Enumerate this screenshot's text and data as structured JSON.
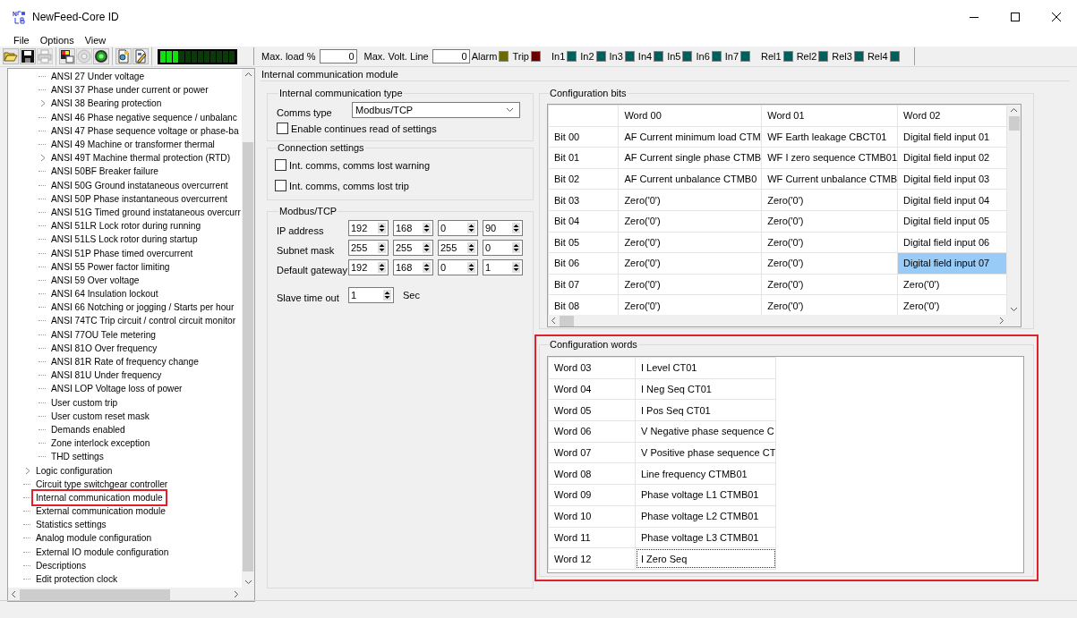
{
  "window": {
    "title": "NewFeed-Core ID"
  },
  "menu": [
    "File",
    "Options",
    "View"
  ],
  "toolbar": {
    "groups": [
      [
        {
          "kind": "open",
          "disabled": false
        },
        {
          "kind": "save",
          "disabled": false
        },
        {
          "kind": "print",
          "disabled": true
        }
      ],
      [
        {
          "kind": "image",
          "disabled": false
        },
        {
          "kind": "disc",
          "disabled": true
        },
        {
          "kind": "target",
          "disabled": false
        }
      ],
      [
        {
          "kind": "doc-gear",
          "disabled": false
        },
        {
          "kind": "doc-edit",
          "disabled": false
        }
      ]
    ],
    "meter": {
      "level": 0.25
    },
    "fields": [
      {
        "label": "Max. load %",
        "value": "0"
      },
      {
        "label": "Max. Volt. Line",
        "value": "0"
      }
    ],
    "indicator_groups": [
      [
        {
          "label": "Alarm",
          "color": "#6b6b00"
        },
        {
          "label": "Trip",
          "color": "#6b0000"
        }
      ],
      [
        {
          "label": "In1",
          "color": "#005f5a"
        },
        {
          "label": "In2",
          "color": "#005f5a"
        },
        {
          "label": "In3",
          "color": "#005f5a"
        },
        {
          "label": "In4",
          "color": "#005f5a"
        },
        {
          "label": "In5",
          "color": "#005f5a"
        },
        {
          "label": "In6",
          "color": "#005f5a"
        },
        {
          "label": "In7",
          "color": "#005f5a"
        }
      ],
      [
        {
          "label": "Rel1",
          "color": "#005f5a"
        },
        {
          "label": "Rel2",
          "color": "#005f5a"
        },
        {
          "label": "Rel3",
          "color": "#005f5a"
        },
        {
          "label": "Rel4",
          "color": "#005f5a"
        }
      ]
    ]
  },
  "tree": {
    "items": [
      {
        "children": [
          {
            "label": "ANSI 27  Under voltage",
            "collapsed": false,
            "marked": false
          },
          {
            "label": "ANSI 37  Phase under current or power",
            "collapsed": false,
            "marked": false
          },
          {
            "label": "ANSI 38  Bearing protection",
            "collapsed": true,
            "marked": false
          },
          {
            "label": "ANSI 46  Phase negative sequence / unbalanc",
            "collapsed": false,
            "marked": false
          },
          {
            "label": "ANSI 47  Phase sequence voltage or phase-ba",
            "collapsed": false,
            "marked": false
          },
          {
            "label": "ANSI 49  Machine or transformer thermal",
            "collapsed": false,
            "marked": false
          },
          {
            "label": "ANSI 49T  Machine thermal protection (RTD)",
            "collapsed": true,
            "marked": false
          },
          {
            "label": "ANSI 50BF Breaker failure",
            "collapsed": false,
            "marked": false
          },
          {
            "label": "ANSI 50G  Ground instataneous overcurrent",
            "collapsed": false,
            "marked": false
          },
          {
            "label": "ANSI 50P  Phase instantaneous overcurrent",
            "collapsed": false,
            "marked": false
          },
          {
            "label": "ANSI 51G  Timed ground instataneous overcurr",
            "collapsed": false,
            "marked": false
          },
          {
            "label": "ANSI 51LR Lock rotor during running",
            "collapsed": false,
            "marked": false
          },
          {
            "label": "ANSI 51LS Lock rotor during startup",
            "collapsed": false,
            "marked": false
          },
          {
            "label": "ANSI 51P  Phase timed overcurrent",
            "collapsed": false,
            "marked": false
          },
          {
            "label": "ANSI 55  Power factor limiting",
            "collapsed": false,
            "marked": false
          },
          {
            "label": "ANSI 59  Over voltage",
            "collapsed": false,
            "marked": false
          },
          {
            "label": "ANSI 64  Insulation lockout",
            "collapsed": false,
            "marked": false
          },
          {
            "label": "ANSI 66  Notching or jogging / Starts per hour",
            "collapsed": false,
            "marked": false
          },
          {
            "label": "ANSI 74TC Trip circuit / control circuit monitor",
            "collapsed": false,
            "marked": false
          },
          {
            "label": "ANSI 77OU Tele metering",
            "collapsed": false,
            "marked": false
          },
          {
            "label": "ANSI 81O  Over frequency",
            "collapsed": false,
            "marked": false
          },
          {
            "label": "ANSI 81R  Rate of frequency change",
            "collapsed": false,
            "marked": false
          },
          {
            "label": "ANSI 81U  Under frequency",
            "collapsed": false,
            "marked": false
          },
          {
            "label": "ANSI LOP  Voltage loss of power",
            "collapsed": false,
            "marked": false
          },
          {
            "label": "User custom trip",
            "collapsed": false,
            "marked": false
          },
          {
            "label": "User custom reset mask",
            "collapsed": false,
            "marked": false
          },
          {
            "label": "Demands enabled",
            "collapsed": false,
            "marked": false
          },
          {
            "label": "Zone interlock exception",
            "collapsed": false,
            "marked": false
          },
          {
            "label": "THD settings",
            "collapsed": false,
            "marked": false
          }
        ]
      },
      {
        "label": "Logic configuration",
        "collapsed": true,
        "marked": false
      },
      {
        "label": "Circuit type switchgear controller",
        "collapsed": false,
        "marked": false
      },
      {
        "label": "Internal communication module",
        "collapsed": false,
        "marked": true
      },
      {
        "label": "External communication module",
        "collapsed": false,
        "marked": false
      },
      {
        "label": "Statistics settings",
        "collapsed": false,
        "marked": false
      },
      {
        "label": "Analog module configuration",
        "collapsed": false,
        "marked": false
      },
      {
        "label": "External IO module configuration",
        "collapsed": false,
        "marked": false
      },
      {
        "label": "Descriptions",
        "collapsed": false,
        "marked": false
      },
      {
        "label": "Edit protection clock",
        "collapsed": false,
        "marked": false
      }
    ]
  },
  "panel": {
    "title": "Internal communication module",
    "comm_type": {
      "title": "Internal communication type",
      "label": "Comms type",
      "value": "Modbus/TCP",
      "checkbox": {
        "label": "Enable continues read of settings",
        "checked": false
      }
    },
    "connection": {
      "title": "Connection settings",
      "checkboxes": [
        {
          "label": "Int. comms, comms lost warning",
          "checked": false
        },
        {
          "label": "Int. comms, comms lost trip",
          "checked": false
        }
      ]
    },
    "modbus": {
      "title": "Modbus/TCP",
      "rows": [
        {
          "label": "IP address",
          "values": [
            "192",
            "168",
            "0",
            "90"
          ]
        },
        {
          "label": "Subnet mask",
          "values": [
            "255",
            "255",
            "255",
            "0"
          ]
        },
        {
          "label": "Default gateway",
          "values": [
            "192",
            "168",
            "0",
            "1"
          ]
        }
      ],
      "timeout": {
        "label": "Slave time out",
        "value": "1",
        "unit": "Sec"
      }
    },
    "config_bits": {
      "title": "Configuration bits",
      "columns": [
        "Word 00",
        "Word 01",
        "Word 02"
      ],
      "rows": [
        {
          "label": "Bit 00",
          "cells": [
            {
              "text": "AF Current minimum load CTM",
              "selected": false
            },
            {
              "text": "WF Earth leakage CBCT01",
              "selected": false
            },
            {
              "text": "Digital field input 01",
              "selected": false
            }
          ]
        },
        {
          "label": "Bit 01",
          "cells": [
            {
              "text": "AF Current single phase CTMB",
              "selected": false
            },
            {
              "text": "WF I zero sequence CTMB01",
              "selected": false
            },
            {
              "text": "Digital field input 02",
              "selected": false
            }
          ]
        },
        {
          "label": "Bit 02",
          "cells": [
            {
              "text": "AF Current unbalance CTMB0",
              "selected": false
            },
            {
              "text": "WF Current unbalance CTMB",
              "selected": false
            },
            {
              "text": "Digital field input 03",
              "selected": false
            }
          ]
        },
        {
          "label": "Bit 03",
          "cells": [
            {
              "text": "Zero('0')",
              "selected": false
            },
            {
              "text": "Zero('0')",
              "selected": false
            },
            {
              "text": "Digital field input 04",
              "selected": false
            }
          ]
        },
        {
          "label": "Bit 04",
          "cells": [
            {
              "text": "Zero('0')",
              "selected": false
            },
            {
              "text": "Zero('0')",
              "selected": false
            },
            {
              "text": "Digital field input 05",
              "selected": false
            }
          ]
        },
        {
          "label": "Bit 05",
          "cells": [
            {
              "text": "Zero('0')",
              "selected": false
            },
            {
              "text": "Zero('0')",
              "selected": false
            },
            {
              "text": "Digital field input 06",
              "selected": false
            }
          ]
        },
        {
          "label": "Bit 06",
          "cells": [
            {
              "text": "Zero('0')",
              "selected": false
            },
            {
              "text": "Zero('0')",
              "selected": false
            },
            {
              "text": "Digital field input 07",
              "selected": true
            }
          ]
        },
        {
          "label": "Bit 07",
          "cells": [
            {
              "text": "Zero('0')",
              "selected": false
            },
            {
              "text": "Zero('0')",
              "selected": false
            },
            {
              "text": "Zero('0')",
              "selected": false
            }
          ]
        },
        {
          "label": "Bit 08",
          "cells": [
            {
              "text": "Zero('0')",
              "selected": false
            },
            {
              "text": "Zero('0')",
              "selected": false
            },
            {
              "text": "Zero('0')",
              "selected": false
            }
          ]
        }
      ]
    },
    "config_words": {
      "title": "Configuration words",
      "marked": true,
      "rows": [
        {
          "label": "Word 03",
          "value": "I Level CT01",
          "editing": false
        },
        {
          "label": "Word 04",
          "value": "I Neg Seq CT01",
          "editing": false
        },
        {
          "label": "Word 05",
          "value": "I Pos Seq CT01",
          "editing": false
        },
        {
          "label": "Word 06",
          "value": "V Negative phase sequence C",
          "editing": false
        },
        {
          "label": "Word 07",
          "value": "V Positive phase sequence CT",
          "editing": false
        },
        {
          "label": "Word 08",
          "value": "Line frequency CTMB01",
          "editing": false
        },
        {
          "label": "Word 09",
          "value": "Phase voltage L1 CTMB01",
          "editing": false
        },
        {
          "label": "Word 10",
          "value": "Phase voltage L2 CTMB01",
          "editing": false
        },
        {
          "label": "Word 11",
          "value": "Phase voltage L3 CTMB01",
          "editing": false
        },
        {
          "label": "Word 12",
          "value": "I Zero Seq",
          "editing": true
        }
      ]
    }
  }
}
